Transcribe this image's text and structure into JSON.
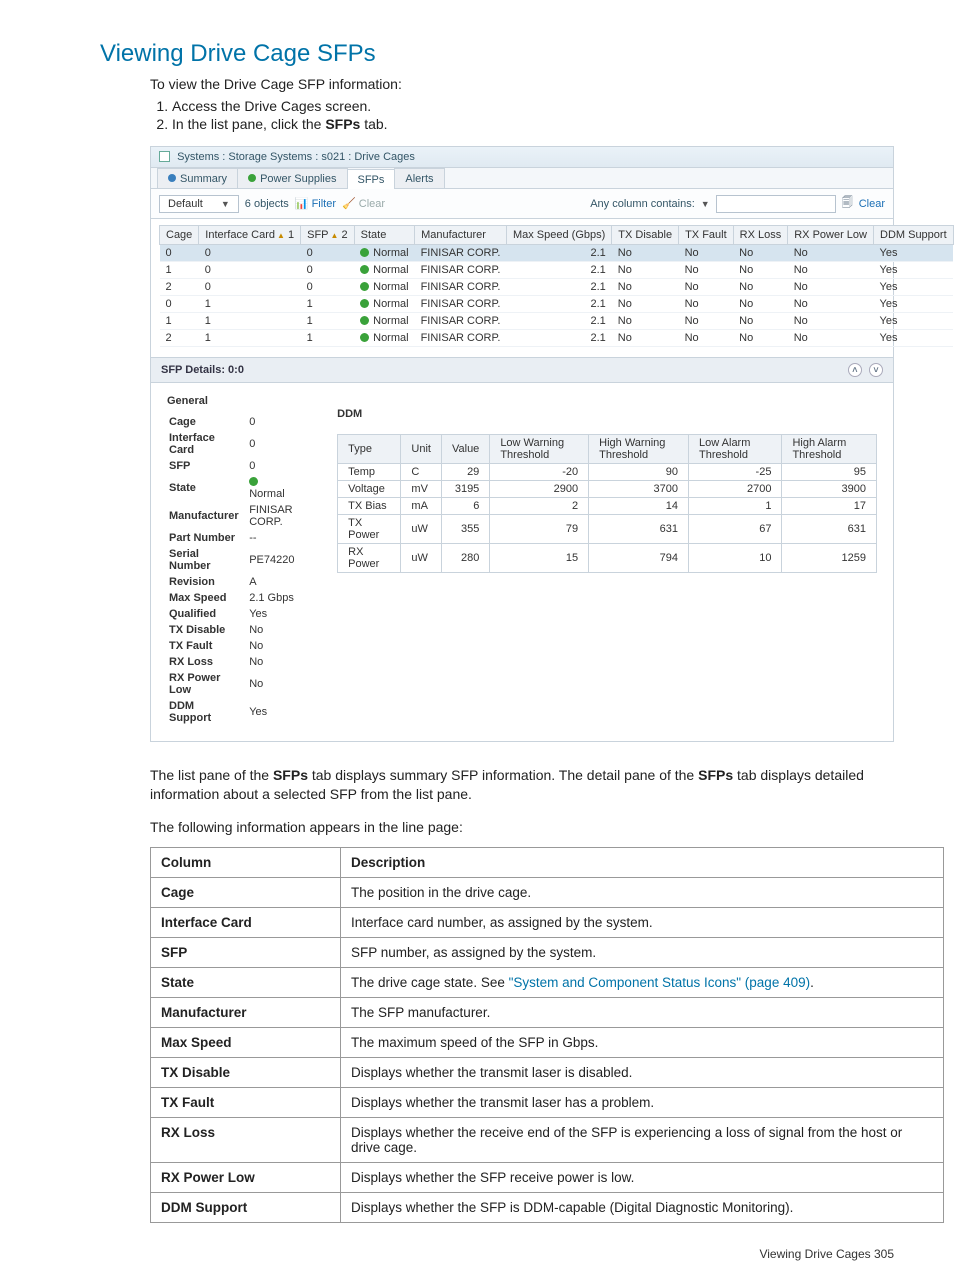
{
  "page": {
    "heading": "Viewing Drive Cage SFPs",
    "intro": "To view the Drive Cage SFP information:",
    "step1": "Access the Drive Cages screen.",
    "step2_a": "In the list pane, click the ",
    "step2_b": "SFPs",
    "step2_c": " tab.",
    "para1a": "The list pane of the ",
    "para1b": "SFPs",
    "para1c": " tab displays summary SFP information. The detail pane of the ",
    "para1d": "SFPs",
    "para1e": " tab displays detailed information about a selected SFP from the list pane.",
    "para2": "The following information appears in the line page:",
    "footer": "Viewing Drive Cages   305"
  },
  "shot": {
    "breadcrumb": "Systems : Storage Systems : s021 : Drive Cages",
    "tabs": {
      "summary": "Summary",
      "power": "Power Supplies",
      "sfps": "SFPs",
      "alerts": "Alerts"
    },
    "toolbar": {
      "default": "Default",
      "count": "6 objects",
      "filter": "Filter",
      "clear": "Clear",
      "anycol": "Any column contains:",
      "clear2": "Clear"
    },
    "cols": {
      "cage": "Cage",
      "ifc": "Interface Card",
      "sfp": "SFP",
      "state": "State",
      "manu": "Manufacturer",
      "max": "Max Speed (Gbps)",
      "txd": "TX Disable",
      "txf": "TX Fault",
      "rxl": "RX Loss",
      "rxp": "RX Power Low",
      "ddm": "DDM Support",
      "sort1": "1",
      "sort2": "2"
    },
    "rows": [
      {
        "cage": "0",
        "ifc": "0",
        "sfp": "0",
        "state": "Normal",
        "manu": "FINISAR CORP.",
        "max": "2.1",
        "txd": "No",
        "txf": "No",
        "rxl": "No",
        "rxp": "No",
        "ddm": "Yes",
        "sel": true
      },
      {
        "cage": "1",
        "ifc": "0",
        "sfp": "0",
        "state": "Normal",
        "manu": "FINISAR CORP.",
        "max": "2.1",
        "txd": "No",
        "txf": "No",
        "rxl": "No",
        "rxp": "No",
        "ddm": "Yes"
      },
      {
        "cage": "2",
        "ifc": "0",
        "sfp": "0",
        "state": "Normal",
        "manu": "FINISAR CORP.",
        "max": "2.1",
        "txd": "No",
        "txf": "No",
        "rxl": "No",
        "rxp": "No",
        "ddm": "Yes"
      },
      {
        "cage": "0",
        "ifc": "1",
        "sfp": "1",
        "state": "Normal",
        "manu": "FINISAR CORP.",
        "max": "2.1",
        "txd": "No",
        "txf": "No",
        "rxl": "No",
        "rxp": "No",
        "ddm": "Yes"
      },
      {
        "cage": "1",
        "ifc": "1",
        "sfp": "1",
        "state": "Normal",
        "manu": "FINISAR CORP.",
        "max": "2.1",
        "txd": "No",
        "txf": "No",
        "rxl": "No",
        "rxp": "No",
        "ddm": "Yes"
      },
      {
        "cage": "2",
        "ifc": "1",
        "sfp": "1",
        "state": "Normal",
        "manu": "FINISAR CORP.",
        "max": "2.1",
        "txd": "No",
        "txf": "No",
        "rxl": "No",
        "rxp": "No",
        "ddm": "Yes"
      }
    ],
    "details_title": "SFP Details: 0:0",
    "general": {
      "title": "General",
      "labels": {
        "cage": "Cage",
        "ifc": "Interface Card",
        "sfp": "SFP",
        "state": "State",
        "manu": "Manufacturer",
        "pn": "Part Number",
        "sn": "Serial Number",
        "rev": "Revision",
        "max": "Max Speed",
        "qual": "Qualified",
        "txd": "TX Disable",
        "txf": "TX Fault",
        "rxl": "RX Loss",
        "rxp": "RX Power Low",
        "ddm": "DDM Support"
      },
      "values": {
        "cage": "0",
        "ifc": "0",
        "sfp": "0",
        "state": "Normal",
        "manu": "FINISAR CORP.",
        "pn": "--",
        "sn": "PE74220",
        "rev": "A",
        "max": "2.1 Gbps",
        "qual": "Yes",
        "txd": "No",
        "txf": "No",
        "rxl": "No",
        "rxp": "No",
        "ddm": "Yes"
      }
    },
    "ddm": {
      "title": "DDM",
      "head": {
        "type": "Type",
        "unit": "Unit",
        "val": "Value",
        "lw": "Low Warning Threshold",
        "hw": "High Warning Threshold",
        "la": "Low Alarm Threshold",
        "ha": "High Alarm Threshold"
      },
      "rows": [
        {
          "type": "Temp",
          "unit": "C",
          "val": "29",
          "lw": "-20",
          "hw": "90",
          "la": "-25",
          "ha": "95"
        },
        {
          "type": "Voltage",
          "unit": "mV",
          "val": "3195",
          "lw": "2900",
          "hw": "3700",
          "la": "2700",
          "ha": "3900"
        },
        {
          "type": "TX Bias",
          "unit": "mA",
          "val": "6",
          "lw": "2",
          "hw": "14",
          "la": "1",
          "ha": "17"
        },
        {
          "type": "TX Power",
          "unit": "uW",
          "val": "355",
          "lw": "79",
          "hw": "631",
          "la": "67",
          "ha": "631"
        },
        {
          "type": "RX Power",
          "unit": "uW",
          "val": "280",
          "lw": "15",
          "hw": "794",
          "la": "10",
          "ha": "1259"
        }
      ]
    }
  },
  "desc": {
    "head": {
      "col": "Column",
      "desc": "Description"
    },
    "rows": [
      {
        "c": "Cage",
        "d": "The position in the drive cage."
      },
      {
        "c": "Interface Card",
        "d": "Interface card number, as assigned by the system."
      },
      {
        "c": "SFP",
        "d": "SFP number, as assigned by the system."
      },
      {
        "c": "State",
        "d_pre": "The drive cage state. See ",
        "link": "\"System and Component Status Icons\" (page 409)",
        "d_post": "."
      },
      {
        "c": "Manufacturer",
        "d": "The SFP manufacturer."
      },
      {
        "c": "Max Speed",
        "d": "The maximum speed of the SFP in Gbps."
      },
      {
        "c": "TX Disable",
        "d": "Displays whether the transmit laser is disabled."
      },
      {
        "c": "TX Fault",
        "d": "Displays whether the transmit laser has a problem."
      },
      {
        "c": "RX Loss",
        "d": "Displays whether the receive end of the SFP is experiencing a loss of signal from the host or drive cage."
      },
      {
        "c": "RX Power Low",
        "d": "Displays whether the SFP receive power is low."
      },
      {
        "c": "DDM Support",
        "d": "Displays whether the SFP is DDM-capable (Digital Diagnostic Monitoring)."
      }
    ]
  }
}
